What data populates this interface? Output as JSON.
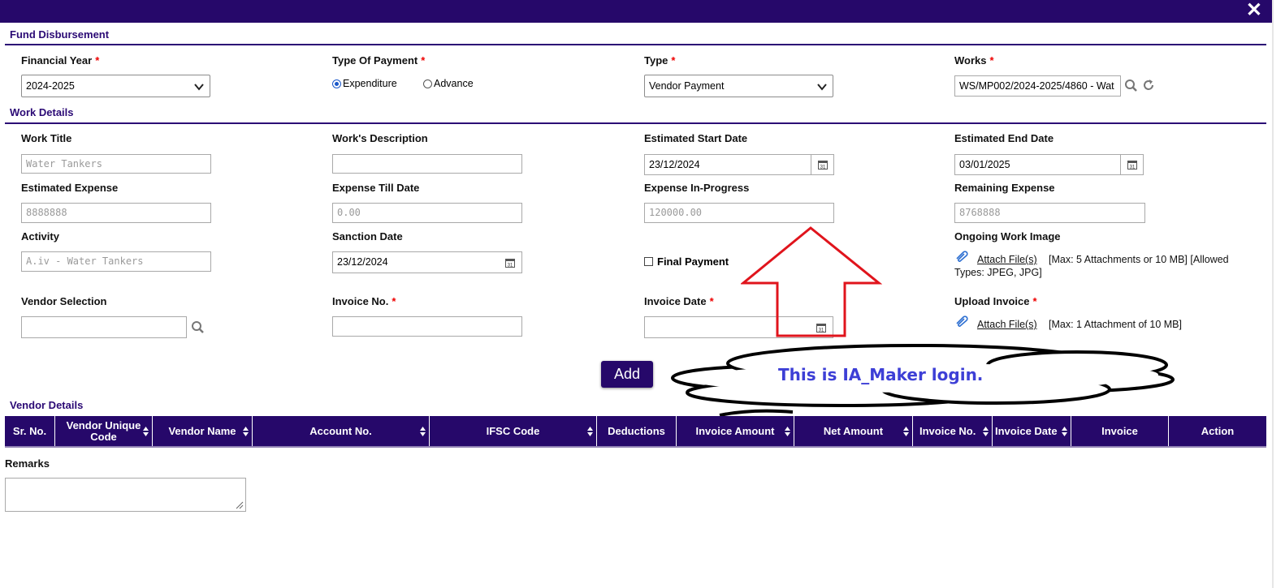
{
  "header": {
    "close_glyph": "✕"
  },
  "fund_section": {
    "title": "Fund Disbursement"
  },
  "financial_year": {
    "label": "Financial Year",
    "required": "*",
    "value": "2024-2025"
  },
  "payment_type": {
    "label": "Type Of Payment",
    "required": "*",
    "options": [
      "Expenditure",
      "Advance"
    ],
    "selected": "Expenditure"
  },
  "type": {
    "label": "Type",
    "required": "*",
    "value": "Vendor Payment"
  },
  "works": {
    "label": "Works",
    "required": "*",
    "value": "WS/MP002/2024-2025/4860 - Wat"
  },
  "work_section": {
    "title": "Work Details"
  },
  "work_title": {
    "label": "Work Title",
    "value": "Water Tankers"
  },
  "work_description": {
    "label": "Work's Description",
    "value": ""
  },
  "est_start_date": {
    "label": "Estimated Start Date",
    "value": "23/12/2024"
  },
  "est_end_date": {
    "label": "Estimated End Date",
    "value": "03/01/2025"
  },
  "est_expense": {
    "label": "Estimated Expense",
    "value": "8888888"
  },
  "expense_till_date": {
    "label": "Expense Till Date",
    "value": "0.00"
  },
  "expense_in_progress": {
    "label": "Expense In-Progress",
    "value": "120000.00"
  },
  "remaining_expense": {
    "label": "Remaining Expense",
    "value": "8768888"
  },
  "activity": {
    "label": "Activity",
    "value": "A.iv - Water Tankers"
  },
  "sanction_date": {
    "label": "Sanction Date",
    "value": "23/12/2024"
  },
  "final_payment": {
    "label": "Final Payment",
    "checked": false
  },
  "ongoing_image": {
    "label": "Ongoing Work Image",
    "link": "Attach File(s)",
    "note1": "[Max: 5 Attachments or 10 MB] [Allowed",
    "note2": "Types: JPEG, JPG]"
  },
  "vendor_selection": {
    "label": "Vendor Selection",
    "value": ""
  },
  "invoice_no": {
    "label": "Invoice No.",
    "required": "*",
    "value": ""
  },
  "invoice_date": {
    "label": "Invoice Date",
    "required": "*",
    "value": ""
  },
  "upload_invoice": {
    "label": "Upload Invoice",
    "required": "*",
    "link": "Attach File(s)",
    "note": "[Max: 1 Attachment of 10 MB]"
  },
  "add_button": {
    "label": "Add"
  },
  "annotation": {
    "text": "This is IA_Maker login.",
    "arrow_color": "#e0141c",
    "text_color": "#3d3fd6"
  },
  "vendor_section": {
    "title": "Vendor Details"
  },
  "table": {
    "columns": [
      "Sr. No.",
      "Vendor Unique Code",
      "Vendor Name",
      "Account No.",
      "IFSC Code",
      "Deductions",
      "Invoice Amount",
      "Net Amount",
      "Invoice No.",
      "Invoice Date",
      "Invoice",
      "Action"
    ],
    "sortable": [
      false,
      true,
      true,
      true,
      true,
      false,
      true,
      true,
      true,
      true,
      false,
      false
    ]
  },
  "remarks": {
    "label": "Remarks",
    "value": ""
  },
  "colors": {
    "primary": "#26086a",
    "section_title": "#2b0a75",
    "required": "#e00000",
    "link": "#0a2fd6"
  }
}
